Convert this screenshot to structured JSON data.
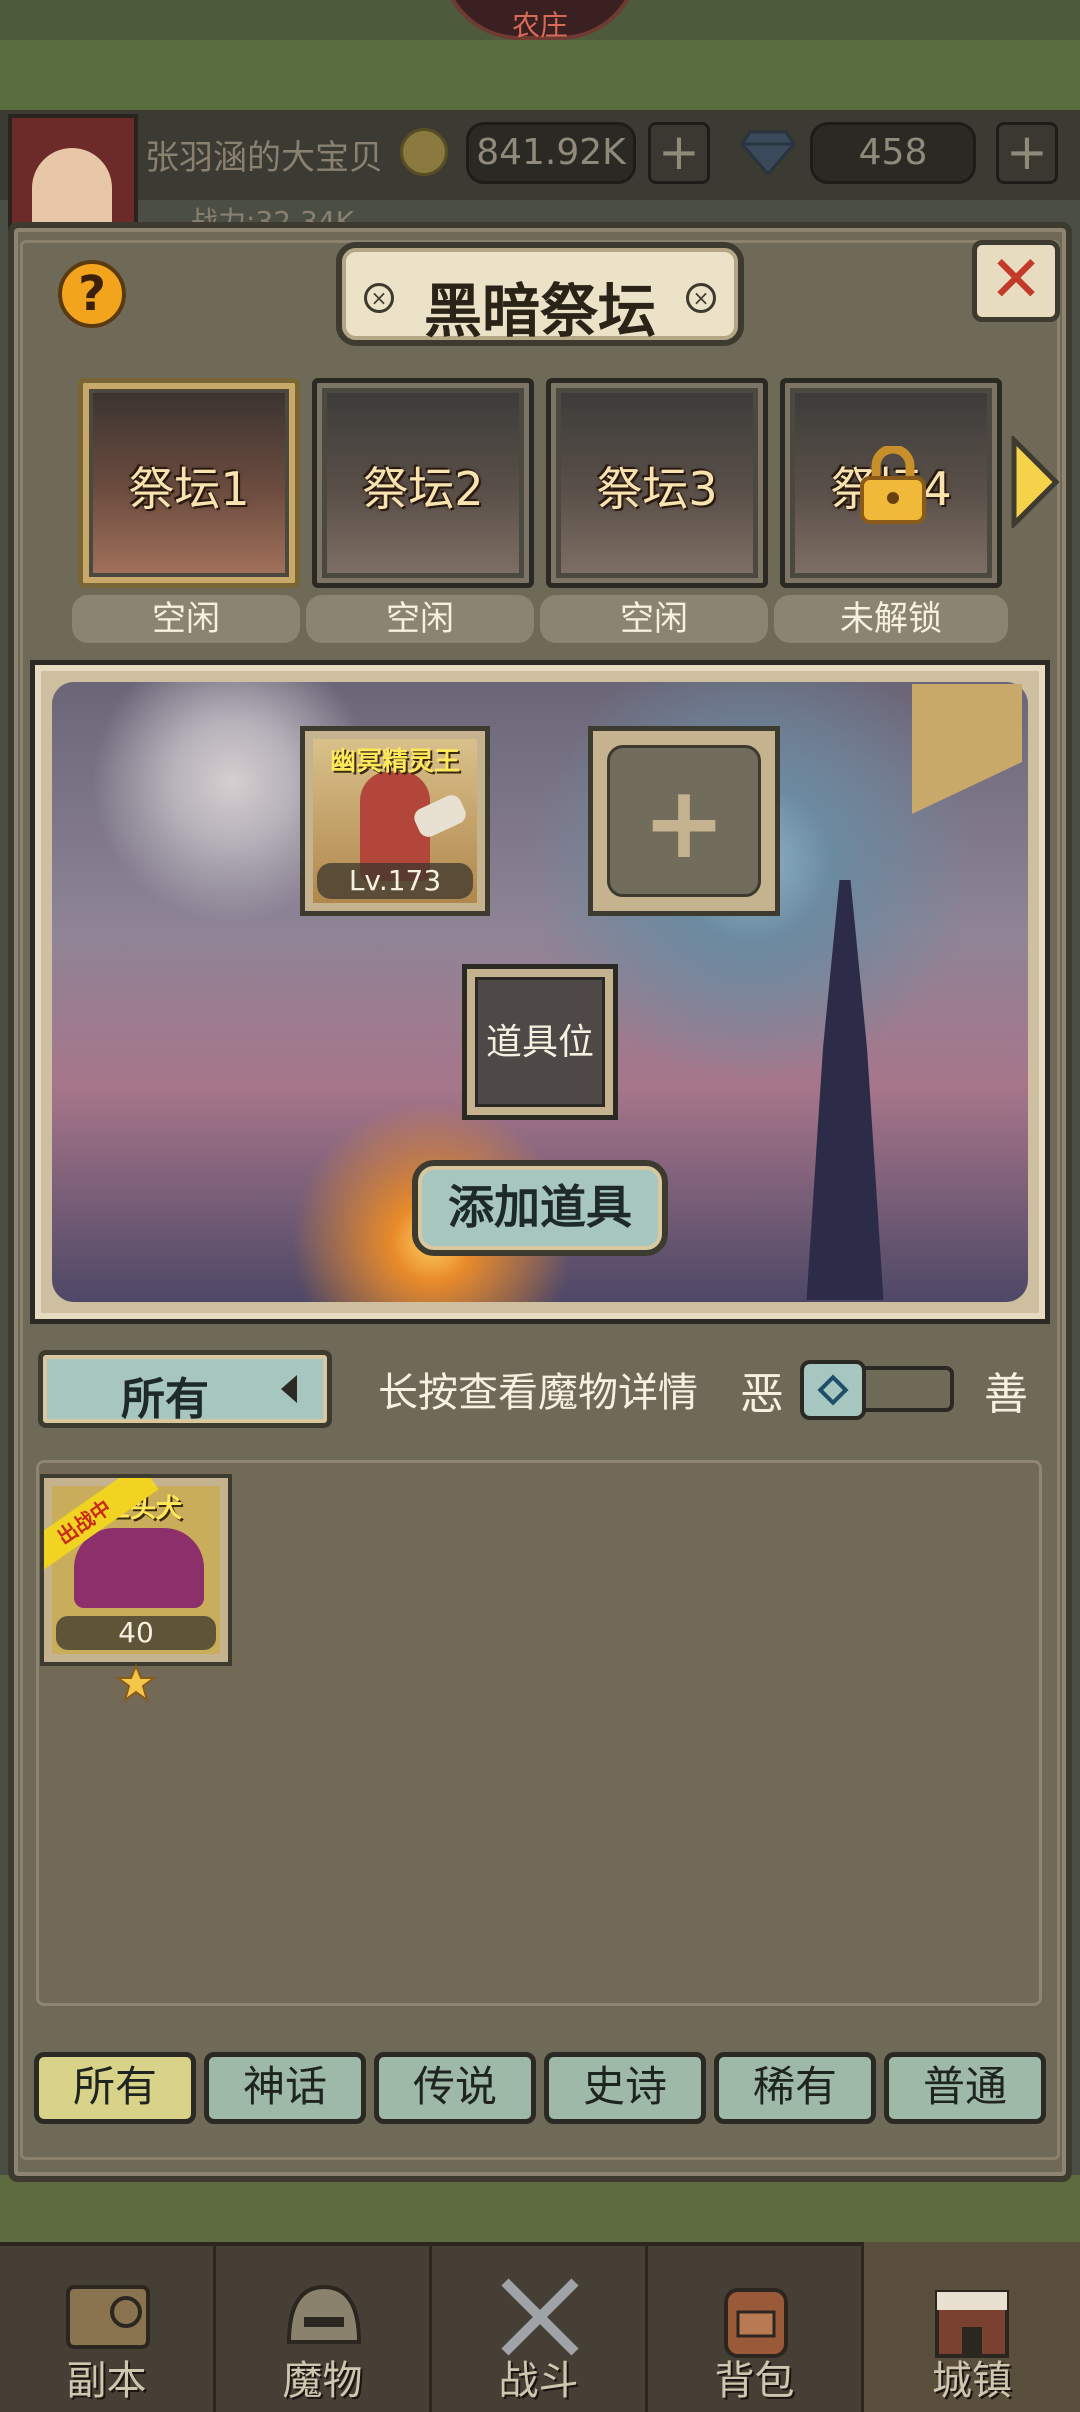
{
  "top_badge": "农庄",
  "player": {
    "name": "张羽涵的大宝贝",
    "power": "战力:32.34K",
    "gold": "841.92K",
    "gems": "458"
  },
  "dialog": {
    "title": "黑暗祭坛",
    "help_label": "?",
    "close_label": "✕"
  },
  "altars": [
    {
      "label": "祭坛1",
      "status": "空闲",
      "locked": false
    },
    {
      "label": "祭坛2",
      "status": "空闲",
      "locked": false
    },
    {
      "label": "祭坛3",
      "status": "空闲",
      "locked": false
    },
    {
      "label": "祭坛4",
      "status": "未解锁",
      "locked": true
    }
  ],
  "slots": {
    "monster": {
      "name": "幽冥精灵王",
      "level": "Lv.173"
    },
    "add_label": "+",
    "item_slot_label": "道具位",
    "add_item_button": "添加道具"
  },
  "filter": {
    "current": "所有",
    "hint": "长按查看魔物详情",
    "evil_label": "恶",
    "good_label": "善"
  },
  "inventory": [
    {
      "name": "三头犬",
      "badge": "出战中",
      "level": "40",
      "stars": 1
    }
  ],
  "rarity_tabs": [
    "所有",
    "神话",
    "传说",
    "史诗",
    "稀有",
    "普通"
  ],
  "nav": [
    "副本",
    "魔物",
    "战斗",
    "背包",
    "城镇"
  ],
  "colors": {
    "accent_tab_active": "#d9d38a",
    "accent_tab": "#9fb9a8",
    "close_red": "#c23a2a",
    "help_orange": "#f2a41c",
    "name_yellow": "#ffe85a"
  }
}
